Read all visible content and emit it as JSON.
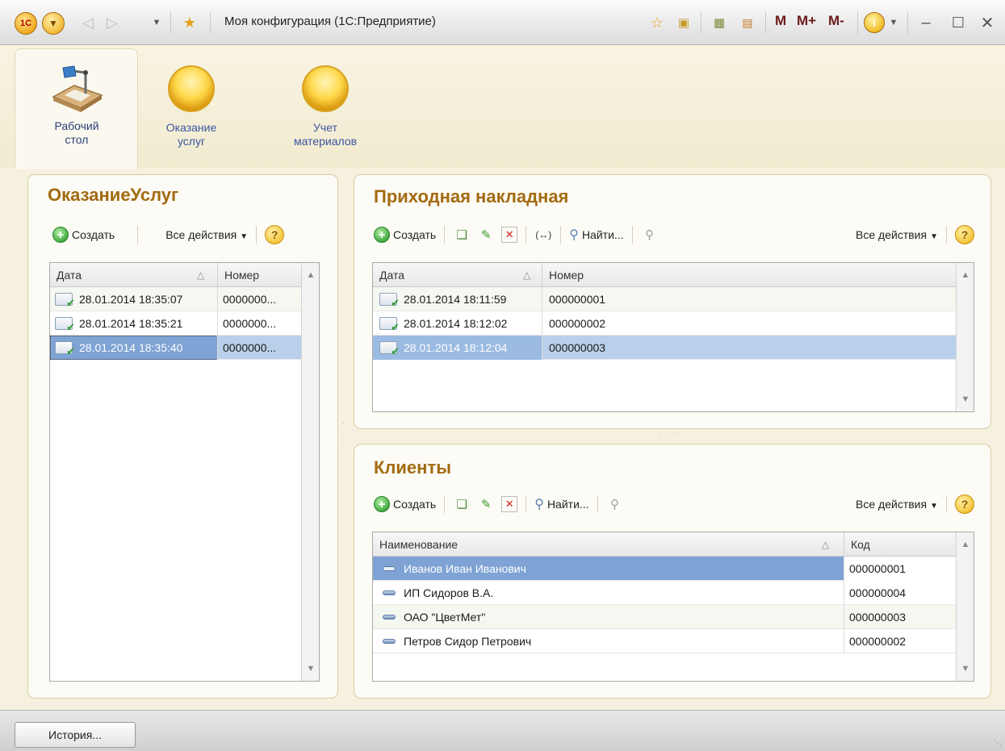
{
  "window": {
    "title": "Моя конфигурация  (1С:Предприятие)",
    "app_icon_label": "1C",
    "m_label": "M",
    "m_plus_label": "M+",
    "m_minus_label": "M-"
  },
  "sections": [
    {
      "label": "Рабочий\nстол",
      "line1": "Рабочий",
      "line2": "стол",
      "active": true
    },
    {
      "label": "Оказание услуг",
      "line1": "Оказание",
      "line2": "услуг",
      "active": false
    },
    {
      "label": "Учет материалов",
      "line1": "Учет",
      "line2": "материалов",
      "active": false
    }
  ],
  "panels": {
    "services": {
      "title": "ОказаниеУслуг",
      "create_label": "Создать",
      "all_actions_label": "Все действия",
      "columns": [
        "Дата",
        "Номер"
      ],
      "rows": [
        {
          "date": "28.01.2014 18:35:07",
          "number": "0000000..."
        },
        {
          "date": "28.01.2014 18:35:21",
          "number": "0000000..."
        },
        {
          "date": "28.01.2014 18:35:40",
          "number": "0000000..."
        }
      ]
    },
    "invoice": {
      "title": "Приходная накладная",
      "create_label": "Создать",
      "find_label": "Найти...",
      "all_actions_label": "Все действия",
      "columns": [
        "Дата",
        "Номер"
      ],
      "rows": [
        {
          "date": "28.01.2014 18:11:59",
          "number": "000000001"
        },
        {
          "date": "28.01.2014 18:12:02",
          "number": "000000002"
        },
        {
          "date": "28.01.2014 18:12:04",
          "number": "000000003"
        }
      ]
    },
    "clients": {
      "title": "Клиенты",
      "create_label": "Создать",
      "find_label": "Найти...",
      "all_actions_label": "Все действия",
      "columns": [
        "Наименование",
        "Код"
      ],
      "rows": [
        {
          "name": "Иванов Иван Иванович",
          "code": "000000001"
        },
        {
          "name": "ИП Сидоров В.А.",
          "code": "000000004"
        },
        {
          "name": "ОАО \"ЦветМет\"",
          "code": "000000003"
        },
        {
          "name": "Петров Сидор Петрович",
          "code": "000000002"
        }
      ]
    }
  },
  "history_label": "История...",
  "colors": {
    "title_accent": "#a36a10",
    "selection": "#b9d0ea",
    "selection_strong": "#7ea3d4",
    "background": "#f5f1de"
  }
}
